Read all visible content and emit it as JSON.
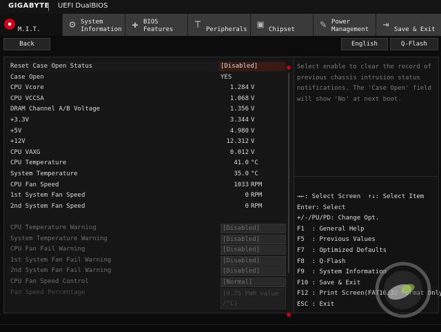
{
  "window": {
    "brand": "GIGABYTE",
    "title": "UEFI DualBIOS"
  },
  "tabs": [
    {
      "label": "M.I.T.",
      "icon": "mit-icon",
      "active": true
    },
    {
      "label": "System\nInformation",
      "icon": "gear-icon"
    },
    {
      "label": "BIOS\nFeatures",
      "icon": "bios-features-icon"
    },
    {
      "label": "Peripherals",
      "icon": "peripherals-icon"
    },
    {
      "label": "Chipset",
      "icon": "chipset-icon"
    },
    {
      "label": "Power\nManagement",
      "icon": "power-icon"
    },
    {
      "label": "Save & Exit",
      "icon": "exit-icon"
    }
  ],
  "toolbar": {
    "back": "Back",
    "language": "English",
    "qflash": "Q-Flash"
  },
  "settings": [
    {
      "label": "Reset Case Open Status",
      "value": "[Disabled]"
    },
    {
      "label": "Case Open",
      "value": "YES"
    },
    {
      "label": "CPU Vcore",
      "value": "1.284",
      "unit": "V"
    },
    {
      "label": "CPU VCCSA",
      "value": "1.068",
      "unit": "V"
    },
    {
      "label": "DRAM Channel A/B Voltage",
      "value": "1.356",
      "unit": "V"
    },
    {
      "label": "+3.3V",
      "value": "3.344",
      "unit": "V"
    },
    {
      "label": "+5V",
      "value": "4.980",
      "unit": "V"
    },
    {
      "label": "+12V",
      "value": "12.312",
      "unit": "V"
    },
    {
      "label": "CPU VAXG",
      "value": "0.012",
      "unit": "V"
    },
    {
      "label": "CPU Temperature",
      "value": "41.0",
      "unit": "°C"
    },
    {
      "label": "System Temperature",
      "value": "35.0",
      "unit": "°C"
    },
    {
      "label": "CPU Fan Speed",
      "value": "1033",
      "unit": "RPM"
    },
    {
      "label": "1st System Fan Speed",
      "value": "0",
      "unit": "RPM"
    },
    {
      "label": "2nd System Fan Speed",
      "value": "0",
      "unit": "RPM"
    }
  ],
  "warnings": [
    {
      "label": "CPU Temperature Warning",
      "value": "[Disabled]"
    },
    {
      "label": "System Temperature Warning",
      "value": "[Disabled]"
    },
    {
      "label": "CPU Fan Fail Warning",
      "value": "[Disabled]"
    },
    {
      "label": "1st System Fan Fail Warning",
      "value": "[Disabled]"
    },
    {
      "label": "2nd System Fan Fail Warning",
      "value": "[Disabled]"
    },
    {
      "label": "CPU Fan Speed Control",
      "value": "[Normal]"
    },
    {
      "label": "Fan Speed Percentage",
      "value": "[0.75 PWM value\n/°C]"
    }
  ],
  "help": {
    "description": "Select enable to clear the record of previous chassis intrusion status notifications. The 'Case Open' field will show 'No' at next boot.",
    "keys": [
      "→←: Select Screen  ↑↓: Select Item",
      "Enter: Select",
      "+/-/PU/PD: Change Opt.",
      "F1  : General Help",
      "F5  : Previous Values",
      "F7  : Optimized Defaults",
      "F8  : Q-Flash",
      "F9  : System Information",
      "F10 : Save & Exit",
      "F12 : Print Screen(FAT16/32 Format Only)",
      "ESC : Exit"
    ]
  },
  "colors": {
    "accent": "#d0001a",
    "selected": "#3a1a12"
  }
}
